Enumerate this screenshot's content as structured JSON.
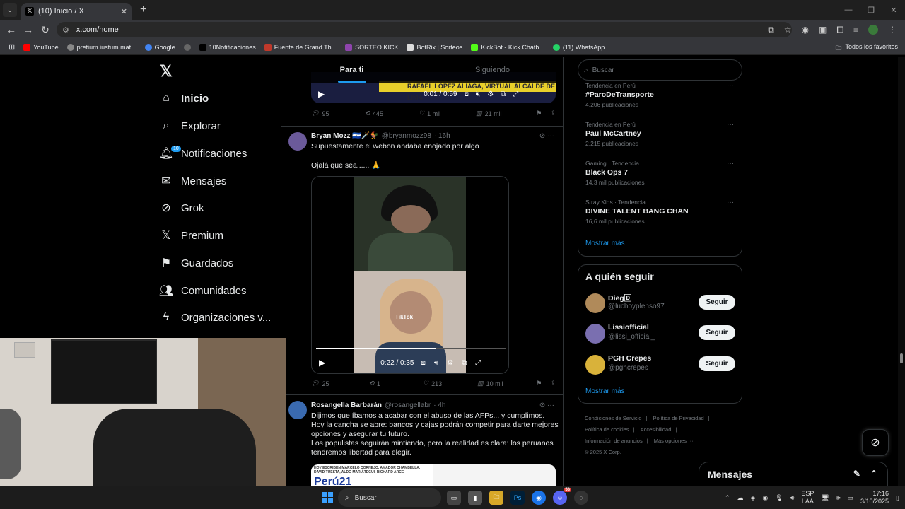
{
  "browser": {
    "tab_title": "(10) Inicio / X",
    "url": "x.com/home",
    "bookmarks": [
      {
        "label": "YouTube",
        "color": "#ff0000"
      },
      {
        "label": "pretium iustum mat...",
        "color": "#888888"
      },
      {
        "label": "Google",
        "color": "#4285f4"
      },
      {
        "label": "",
        "color": "#666666"
      },
      {
        "label": "10Notificaciones",
        "color": "#000000"
      },
      {
        "label": "Fuente de Grand Th...",
        "color": "#c0392b"
      },
      {
        "label": "SORTEO KICK",
        "color": "#8e44ad"
      },
      {
        "label": "BotRix | Sorteos",
        "color": "#dddddd"
      },
      {
        "label": "KickBot - Kick Chatb...",
        "color": "#53fc18"
      },
      {
        "label": "(11) WhatsApp",
        "color": "#25d366"
      }
    ],
    "all_bookmarks": "Todos los favoritos"
  },
  "nav": {
    "items": [
      {
        "label": "Inicio",
        "icon": "home-icon"
      },
      {
        "label": "Explorar",
        "icon": "search-icon"
      },
      {
        "label": "Notificaciones",
        "icon": "bell-icon",
        "badge": "10"
      },
      {
        "label": "Mensajes",
        "icon": "mail-icon"
      },
      {
        "label": "Grok",
        "icon": "grok-icon"
      },
      {
        "label": "Premium",
        "icon": "x-icon"
      },
      {
        "label": "Guardados",
        "icon": "bookmark-icon"
      },
      {
        "label": "Comunidades",
        "icon": "people-icon"
      },
      {
        "label": "Organizaciones v...",
        "icon": "bolt-icon"
      }
    ]
  },
  "feed": {
    "tabs": [
      "Para ti",
      "Siguiendo"
    ],
    "top_video": {
      "banner": "RAFAEL LÓPEZ ALIAGA, VIRTUAL ALCALDE DE LIMA",
      "time": "0:01 / 0:59"
    },
    "top_actions": {
      "replies": "95",
      "reposts": "445",
      "likes": "1 mil",
      "views": "21 mil"
    },
    "tweet1": {
      "name": "Bryan Mozz 🇸🇻🗡️🐓",
      "handle": "@bryanmozz98",
      "time": "· 16h",
      "text1": "Supuestamente el webon andaba enojado por algo",
      "text2": "Ojalá que sea...... 🙏",
      "video_time": "0:22 / 0:35",
      "video_progress": 0.63,
      "watermark": "TikTok",
      "replies": "25",
      "reposts": "1",
      "likes": "213",
      "views": "10 mil"
    },
    "tweet2": {
      "name": "Rosangella Barbarán",
      "handle": "@rosangellabr",
      "time": "· 4h",
      "text": "Dijimos que íbamos a acabar con el abuso de las AFPs... y cumplimos.\nHoy la cancha se abre: bancos y cajas podrán competir para darte mejores opciones y asegurar tu futuro.\nLos populistas seguirán mintiendo, pero la realidad es clara: los peruanos tendremos libertad para elegir.",
      "image_headline": "HOY ESCRIBEN MARCELO CORNEJO, AMADOR CHAMBELLA, DAVID TUESTA, ALDO MARIÁTEGUI, RICHARD ARCE",
      "image_masthead": "Perú21"
    }
  },
  "right": {
    "search_placeholder": "Buscar",
    "trends": [
      {
        "context": "Tendencia en Perú",
        "title": "#ParoDeTransporte",
        "count": "4.206 publicaciones"
      },
      {
        "context": "Tendencia en Perú",
        "title": "Paul McCartney",
        "count": "2.215 publicaciones"
      },
      {
        "context": "Gaming · Tendencia",
        "title": "Black Ops 7",
        "count": "14,3 mil publicaciones"
      },
      {
        "context": "Stray Kids · Tendencia",
        "title": "DIVINE TALENT BANG CHAN",
        "count": "16,6 mil publicaciones"
      }
    ],
    "show_more": "Mostrar más",
    "who_to_follow_title": "A quién seguir",
    "follow": [
      {
        "name": "Dieg🄳",
        "handle": "@luchoyplenso97",
        "button": "Seguir",
        "color": "#b08a5a"
      },
      {
        "name": "Lissiofficial",
        "handle": "@lissi_official_",
        "button": "Seguir",
        "color": "#7a6fb0"
      },
      {
        "name": "PGH Crepes",
        "handle": "@pghcrepes",
        "button": "Seguir",
        "color": "#d9b23a"
      }
    ],
    "footer": [
      "Condiciones de Servicio",
      "Política de Privacidad",
      "Política de cookies",
      "Accesibilidad",
      "Información de anuncios",
      "Más opciones ···",
      "© 2025 X Corp."
    ]
  },
  "messages_bar": {
    "title": "Mensajes"
  },
  "taskbar": {
    "search_label": "Buscar",
    "lang1": "ESP",
    "lang2": "LAA",
    "time": "17:16",
    "date": "3/10/2025",
    "discord_badge": "58"
  },
  "colors": {
    "accent": "#1d9bf0",
    "bg": "#000000",
    "border": "#2f3336",
    "muted": "#71767b"
  }
}
